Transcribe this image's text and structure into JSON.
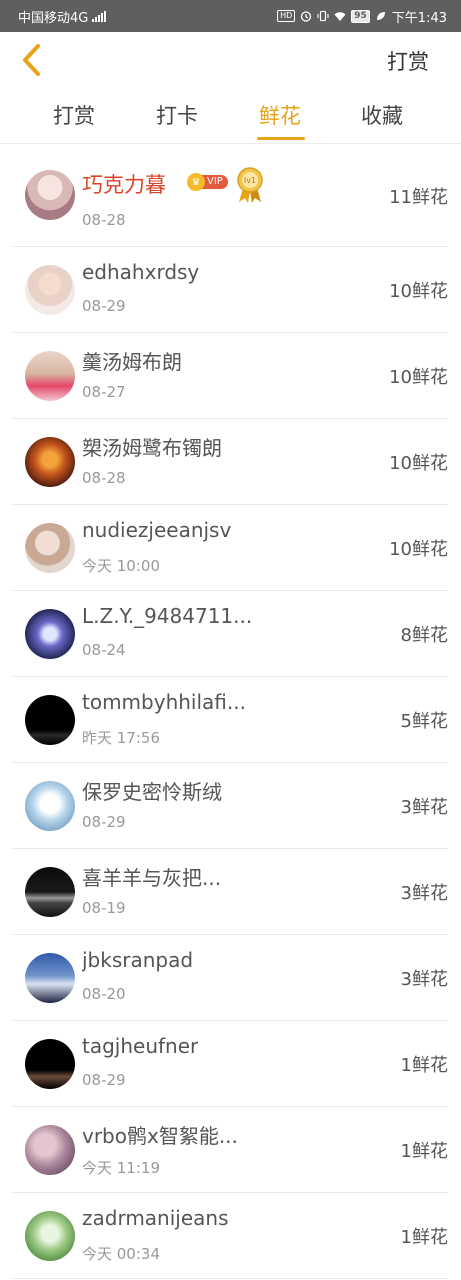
{
  "status_bar": {
    "carrier": "中国移动4G",
    "net_type": "4G",
    "hd": "HD",
    "battery": "95",
    "time": "下午1:43"
  },
  "nav": {
    "back_icon": "chevron-left-icon",
    "action_label": "打赏"
  },
  "tabs": [
    {
      "label": "打赏",
      "active": false
    },
    {
      "label": "打卡",
      "active": false
    },
    {
      "label": "鲜花",
      "active": true
    },
    {
      "label": "收藏",
      "active": false
    }
  ],
  "accent_color": "#e8a317",
  "highlight_name_color": "#d9462a",
  "first_row_badges": {
    "vip_label": "VIP",
    "level_label": "lv1"
  },
  "rows": [
    {
      "name": "巧克力暮",
      "date": "08-28",
      "amount": "11鲜花"
    },
    {
      "name": "edhahxrdsy",
      "date": "08-29",
      "amount": "10鲜花"
    },
    {
      "name": "羹汤姆布朗",
      "date": "08-27",
      "amount": "10鲜花"
    },
    {
      "name": "槊汤姆鹭布镯朗",
      "date": "08-28",
      "amount": "10鲜花"
    },
    {
      "name": "nudiezjeeanjsv",
      "date": "今天 10:00",
      "amount": "10鲜花"
    },
    {
      "name": "L.Z.Y._9484711...",
      "date": "08-24",
      "amount": "8鲜花"
    },
    {
      "name": "tommbyhhilafi...",
      "date": "昨天 17:56",
      "amount": "5鲜花"
    },
    {
      "name": "保罗史密怜斯绒",
      "date": "08-29",
      "amount": "3鲜花"
    },
    {
      "name": "喜羊羊与灰把...",
      "date": "08-19",
      "amount": "3鲜花"
    },
    {
      "name": "jbksranpad",
      "date": "08-20",
      "amount": "3鲜花"
    },
    {
      "name": "tagjheufner",
      "date": "08-29",
      "amount": "1鲜花"
    },
    {
      "name": "vrbo鹘x智絮能...",
      "date": "今天 11:19",
      "amount": "1鲜花"
    },
    {
      "name": "zadrmanijeans",
      "date": "今天 00:34",
      "amount": "1鲜花"
    }
  ]
}
